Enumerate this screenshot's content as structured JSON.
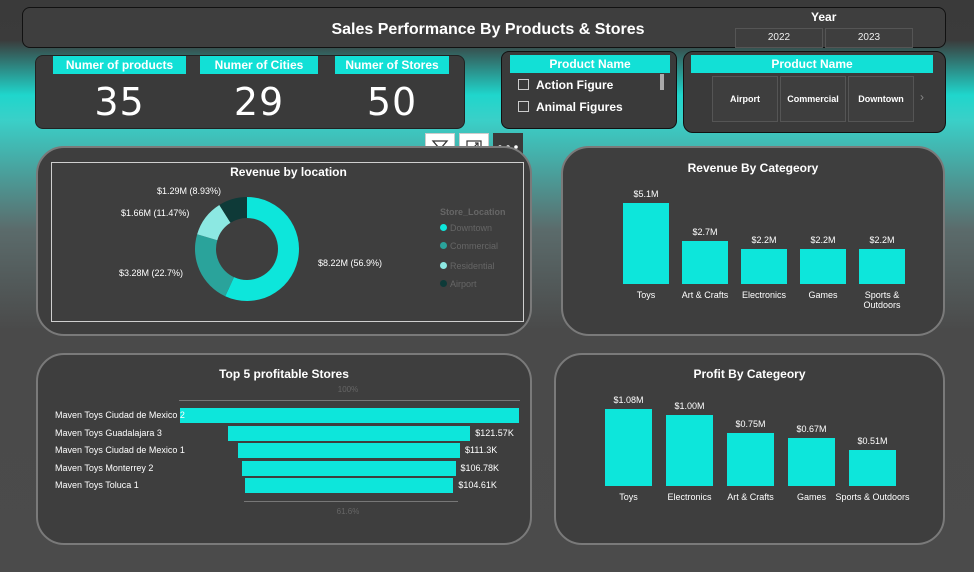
{
  "header": {
    "title": "Sales Performance By Products & Stores"
  },
  "year_slicer": {
    "label": "Year",
    "options": [
      "2022",
      "2023"
    ]
  },
  "kpis": [
    {
      "label": "Numer of products",
      "value": "35"
    },
    {
      "label": "Numer of Cities",
      "value": "29"
    },
    {
      "label": "Numer of Stores",
      "value": "50"
    }
  ],
  "product_slicer": {
    "title": "Product Name",
    "items": [
      "Action Figure",
      "Animal Figures"
    ]
  },
  "location_slicer": {
    "title": "Product Name",
    "tiles": [
      "Airport",
      "Commercial",
      "Downtown"
    ]
  },
  "visual_toolbar": {
    "icons": [
      "filter-icon",
      "focus-mode-icon",
      "more-options-icon"
    ]
  },
  "revenue_by_location": {
    "title": "Revenue by location",
    "legend_title": "Store_Location",
    "chart_data": {
      "type": "pie",
      "donut": true,
      "slices": [
        {
          "name": "Downtown",
          "value": 8.22,
          "label": "$8.22M (56.9%)",
          "color": "#0de6db"
        },
        {
          "name": "Commercial",
          "value": 3.28,
          "label": "$3.28M (22.7%)",
          "color": "#2aa39b"
        },
        {
          "name": "Residential",
          "value": 1.66,
          "label": "$1.66M (11.47%)",
          "color": "#8ce8e2"
        },
        {
          "name": "Airport",
          "value": 1.29,
          "label": "$1.29M (8.93%)",
          "color": "#0e3a38"
        }
      ]
    }
  },
  "revenue_by_category": {
    "title": "Revenue By Categeory",
    "chart_data": {
      "type": "bar",
      "categories": [
        "Toys",
        "Art & Crafts",
        "Electronics",
        "Games",
        "Sports & Outdoors"
      ],
      "values": [
        5.1,
        2.7,
        2.2,
        2.2,
        2.2
      ],
      "labels": [
        "$5.1M",
        "$2.7M",
        "$2.2M",
        "$2.2M",
        "$2.2M"
      ]
    }
  },
  "top_stores": {
    "title": "Top 5 profitable Stores",
    "axis_top": "100%",
    "axis_bottom": "61.6%",
    "chart_data": {
      "type": "bar",
      "orientation": "horizontal-funnel",
      "categories": [
        "Maven Toys Ciudad de Mexico 2",
        "Maven Toys Guadalajara 3",
        "Maven Toys Ciudad de Mexico 1",
        "Maven Toys Monterrey 2",
        "Maven Toys Toluca 1"
      ],
      "values": [
        169.9,
        121.57,
        111.3,
        106.78,
        104.61
      ],
      "labels": [
        "",
        "$121.57K",
        "$111.3K",
        "$106.78K",
        "$104.61K"
      ]
    }
  },
  "profit_by_category": {
    "title": "Profit By Categeory",
    "chart_data": {
      "type": "bar",
      "categories": [
        "Toys",
        "Electronics",
        "Art & Crafts",
        "Games",
        "Sports & Outdoors"
      ],
      "values": [
        1.08,
        1.0,
        0.75,
        0.67,
        0.51
      ],
      "labels": [
        "$1.08M",
        "$1.00M",
        "$0.75M",
        "$0.67M",
        "$0.51M"
      ]
    }
  }
}
